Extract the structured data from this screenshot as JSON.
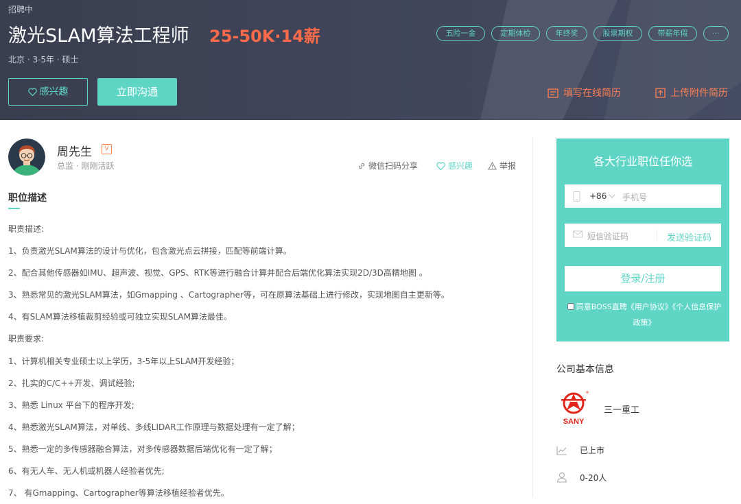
{
  "header": {
    "status": "招聘中",
    "title": "激光SLAM算法工程师",
    "salary": "25-50K·14薪",
    "meta": "北京 · 3-5年 · 硕士",
    "tags": [
      "五险一金",
      "定期体检",
      "年终奖",
      "股票期权",
      "带薪年假",
      "···"
    ],
    "interest_button": "感兴趣",
    "chat_button": "立即沟通",
    "fill_resume": "填写在线简历",
    "upload_resume": "上传附件简历"
  },
  "recruiter": {
    "name": "周先生",
    "badge": "V",
    "title_status": "总监 · 刚刚活跃"
  },
  "actions": {
    "share": "微信扫码分享",
    "interest": "感兴趣",
    "report": "举报"
  },
  "section": {
    "title": "职位描述"
  },
  "description": [
    "职责描述:",
    "1、负责激光SLAM算法的设计与优化，包含激光点云拼接，匹配等前端计算。",
    "2、配合其他传感器如IMU、超声波、视觉、GPS、RTK等进行融合计算并配合后端优化算法实现2D/3D高精地图 。",
    "3、熟悉常见的激光SLAM算法，如Gmapping 、Cartographer等，可在原算法基础上进行修改，实现地图自主更新等。",
    "4、有SLAM算法移植裁剪经验或可独立实现SLAM算法最佳。",
    "职责要求:",
    "1、计算机相关专业硕士以上学历，3-5年以上SLAM开发经验；",
    "2、扎实的C/C++开发、调试经验;",
    "3、熟悉 Linux 平台下的程序开发;",
    "4、熟悉激光SLAM算法，对单线、多线LIDAR工作原理与数据处理有一定了解；",
    "5、熟悉一定的多传感器融合算法，对多传感器数据后端优化有一定了解；",
    "6、有无人车、无人机或机器人经验者优先;",
    "7、 有Gmapping、Cartographer等算法移植经验者优先。"
  ],
  "login": {
    "title": "各大行业职位任你选",
    "country_code": "+86",
    "phone_placeholder": "手机号",
    "code_placeholder": "短信验证码",
    "send_code": "发送验证码",
    "submit": "登录/注册",
    "agreement": "同意BOSS直聘《用户协议》《个人信息保护政策》"
  },
  "company": {
    "heading": "公司基本信息",
    "logo_text": "SANY",
    "name": "三一重工",
    "stage": "已上市",
    "size": "0-20人"
  },
  "colors": {
    "accent": "#5fd5c6",
    "salary": "#ff6b4a",
    "link_orange": "#ff7f50",
    "banner": "#40455a",
    "logo_red": "#e1251b"
  }
}
